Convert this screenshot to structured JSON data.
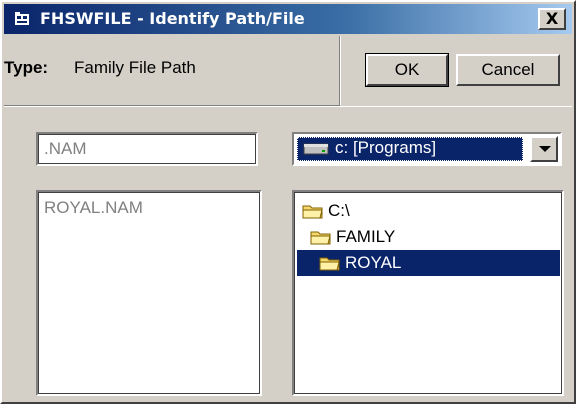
{
  "window": {
    "title": "FHSWFILE - Identify Path/File",
    "close_label": "X"
  },
  "header": {
    "type_label": "Type:",
    "type_value": "Family File Path",
    "ok_label": "OK",
    "cancel_label": "Cancel"
  },
  "filter": {
    "extension_value": ".NAM"
  },
  "drive": {
    "selected": "c: [Programs]"
  },
  "files": {
    "items": [
      "ROYAL.NAM"
    ]
  },
  "directories": {
    "items": [
      {
        "label": "C:\\",
        "selected": false
      },
      {
        "label": "FAMILY",
        "selected": false
      },
      {
        "label": "ROYAL",
        "selected": true
      }
    ]
  },
  "colors": {
    "title_bar": "#0a246a",
    "selection": "#0a246a",
    "face": "#d4d0c8",
    "folder": "#f5d76e"
  }
}
